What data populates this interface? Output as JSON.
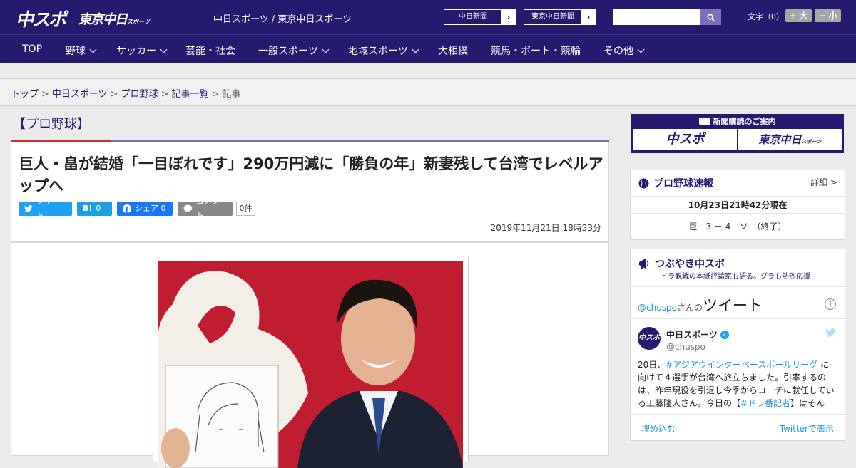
{
  "header": {
    "logo_main": "中スポ",
    "logo_tokyo": "東京中日",
    "logo_tokyo_small": "スポーツ",
    "site_title": "中日スポーツ / 東京中日スポーツ",
    "ext_links": [
      "中日新聞",
      "東京中日新聞"
    ],
    "search_placeholder": "",
    "font_size_label": "文字（0）",
    "font_up": "+ 大",
    "font_down": "− 小"
  },
  "nav": {
    "items": [
      {
        "label": "TOP",
        "dropdown": false
      },
      {
        "label": "野球",
        "dropdown": true
      },
      {
        "label": "サッカー",
        "dropdown": true
      },
      {
        "label": "芸能・社会",
        "dropdown": false
      },
      {
        "label": "一般スポーツ",
        "dropdown": true
      },
      {
        "label": "地域スポーツ",
        "dropdown": true
      },
      {
        "label": "大相撲",
        "dropdown": false
      },
      {
        "label": "競馬・ボート・競輪",
        "dropdown": false
      },
      {
        "label": "その他",
        "dropdown": true
      }
    ]
  },
  "breadcrumb": {
    "items": [
      "トップ",
      "中日スポーツ",
      "プロ野球",
      "記事一覧"
    ],
    "current": "記事",
    "separator": ">"
  },
  "article": {
    "category": "【プロ野球】",
    "headline": "巨人・畠が結婚「一目ぼれです」290万円減に「勝負の年」新妻残して台湾でレベルアップへ",
    "share": {
      "tweet": "ツイート",
      "hatena_icon": "B!",
      "hatena_count": "0",
      "facebook": "シェア 0",
      "comment": "コメント",
      "comment_count": "0件"
    },
    "timestamp": "2019年11月21日 18時33分"
  },
  "sidebar": {
    "ad_title": "新聞購読のご案内",
    "ad_logos": [
      "中スポ",
      "東京中日"
    ],
    "ad_logo_small": "スポーツ",
    "baseball": {
      "title": "プロ野球速報",
      "detail": "詳細 >",
      "time": "10月23日21時42分現在",
      "score": "巨　3 － 4　ソ　（終了）"
    },
    "tweets": {
      "title": "つぶやき中スポ",
      "subtitle": "ドラ観戦の本紙評論家も語る。グラも熱烈応援",
      "widget_handle_link": "@chuspo",
      "widget_handle_suffix": "さんの",
      "widget_heading": "ツイート",
      "account_name": "中日スポーツ",
      "account_handle": "@chuspo",
      "avatar_text": "中スポ",
      "tweet_text_1": "20日、",
      "tweet_tag_1": "#アジアウインターベースボールリーグ",
      "tweet_text_2": " に向けて４選手が台湾へ旅立ちました。引率するのは、昨年現役を引退し今季からコーチに就任している工藤隆人さん。今日の【",
      "tweet_tag_2": "#ドラ番記者",
      "tweet_text_3": "】はそんな“新米",
      "embed": "埋め込む",
      "view": "Twitterで表示"
    }
  },
  "colors": {
    "brand_navy": "#241b6e",
    "accent_red": "#d62b37",
    "accent_purple": "#7a6fba",
    "twitter_blue": "#1da1f2",
    "facebook_blue": "#1877f2"
  }
}
